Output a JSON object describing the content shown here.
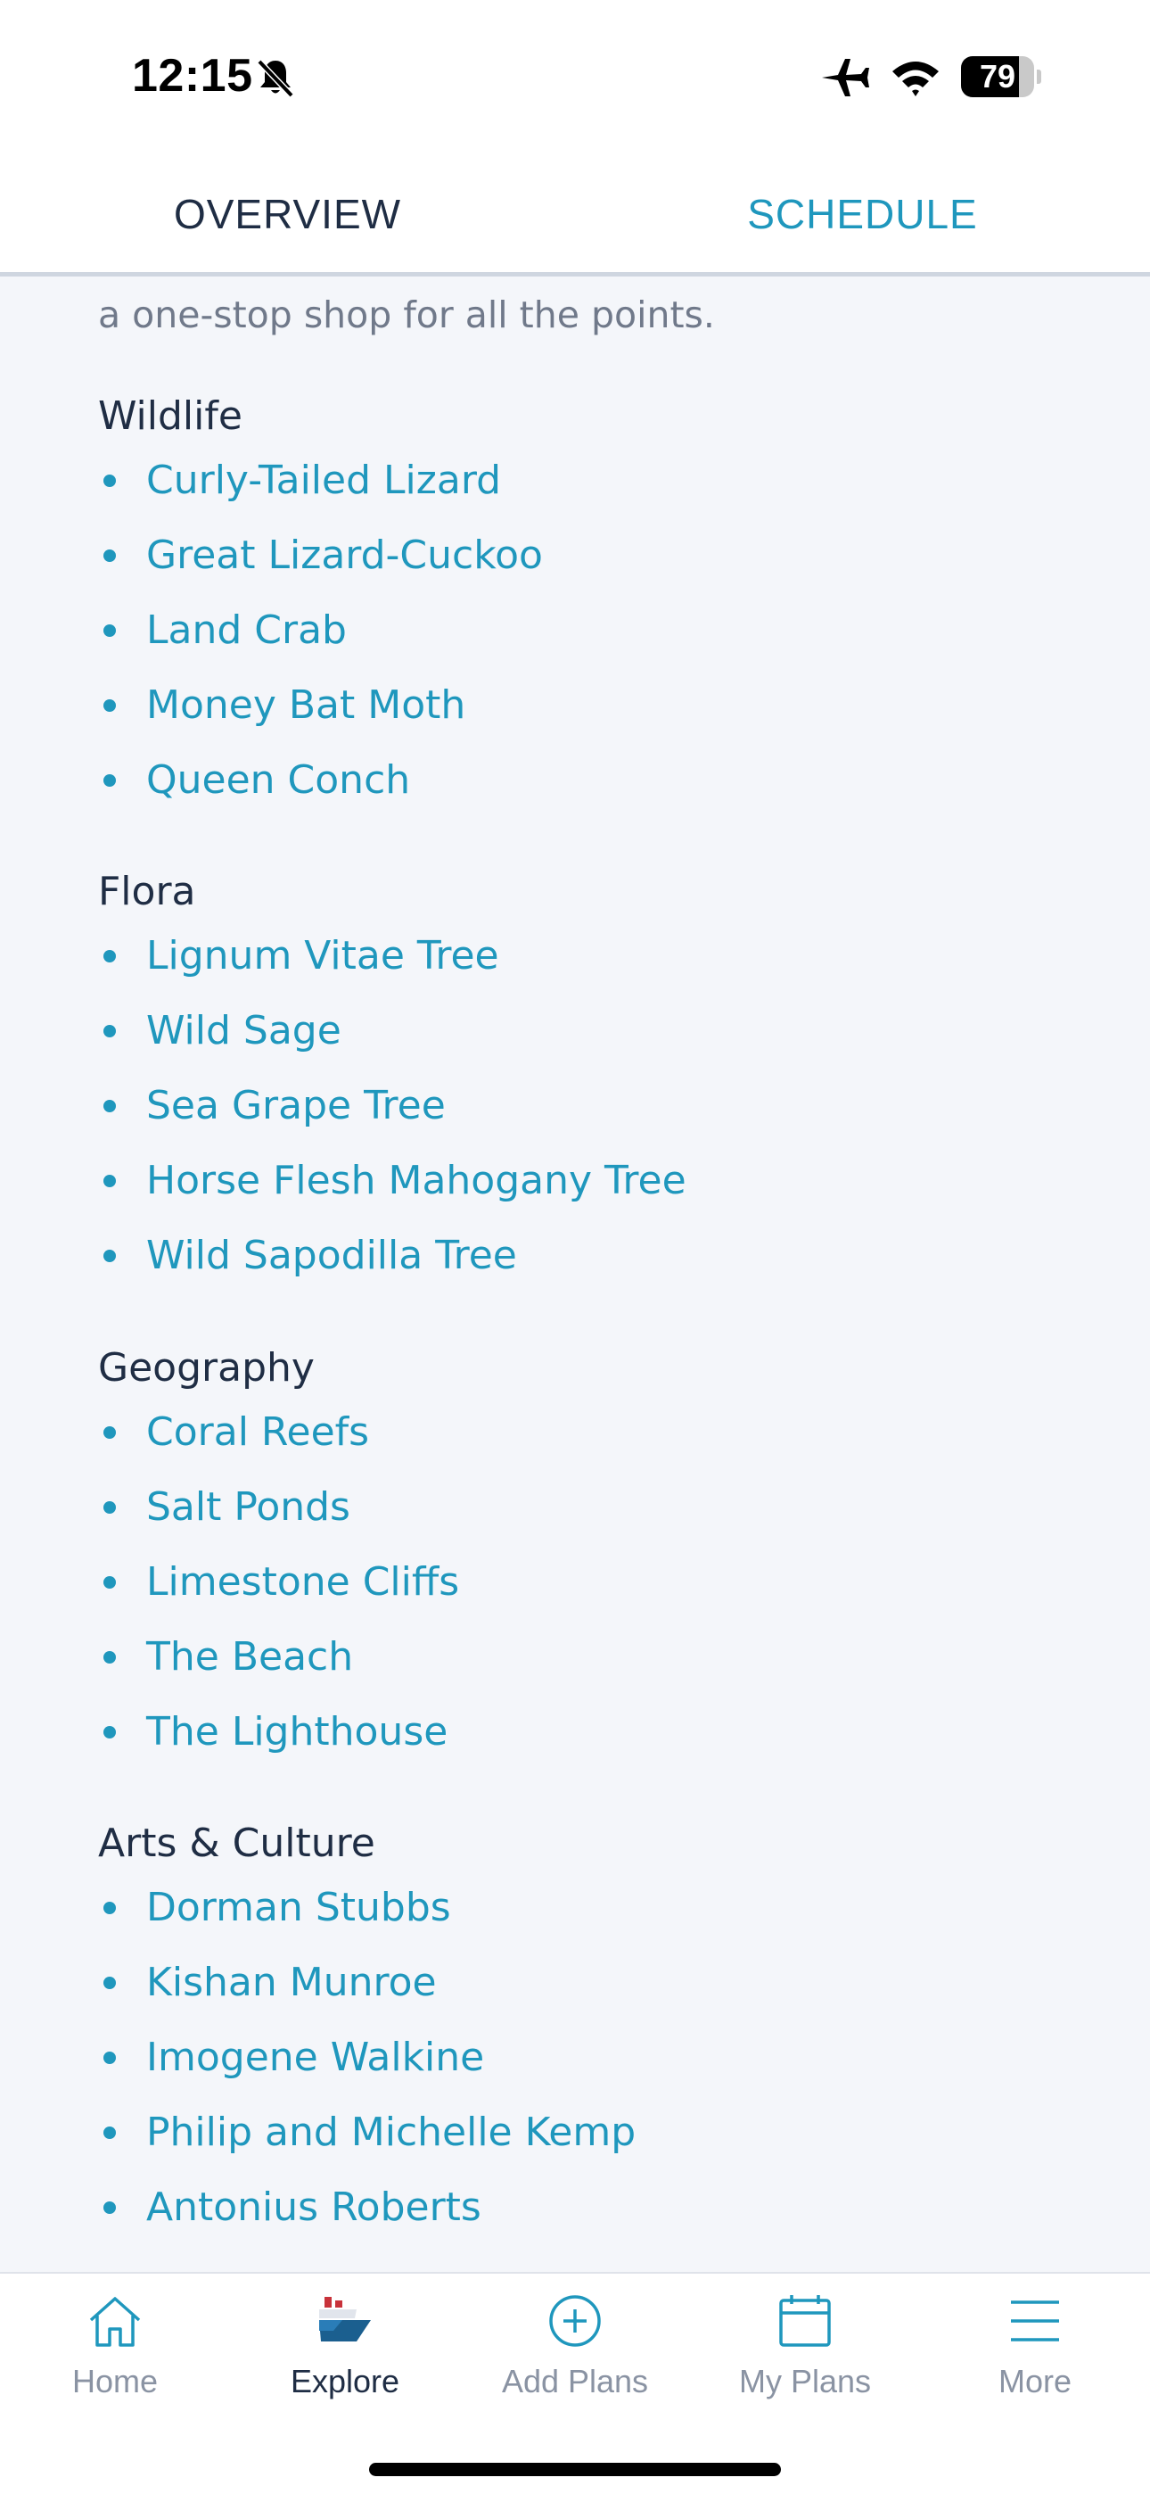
{
  "status_bar": {
    "time": "12:15",
    "battery_level": "79",
    "battery_fraction": 0.79,
    "icons": [
      "bell-off-icon",
      "airplane-icon",
      "wifi-icon",
      "battery-icon"
    ]
  },
  "tabs": [
    {
      "label": "OVERVIEW",
      "active": false
    },
    {
      "label": "SCHEDULE",
      "active": true
    }
  ],
  "content": {
    "intro_tail": "a one-stop shop for all the points.",
    "sections": [
      {
        "title": "Wildlife",
        "items": [
          "Curly-Tailed Lizard",
          "Great Lizard-Cuckoo",
          "Land Crab",
          "Money Bat Moth",
          "Queen Conch"
        ]
      },
      {
        "title": "Flora",
        "items": [
          "Lignum Vitae Tree",
          "Wild Sage",
          "Sea Grape Tree",
          "Horse Flesh Mahogany Tree",
          "Wild Sapodilla Tree"
        ]
      },
      {
        "title": "Geography",
        "items": [
          "Coral Reefs",
          "Salt Ponds",
          "Limestone Cliffs",
          "The Beach",
          "The Lighthouse"
        ]
      },
      {
        "title": "Arts & Culture",
        "items": [
          "Dorman Stubbs",
          "Kishan Munroe",
          "Imogene Walkine",
          "Philip and Michelle Kemp",
          "Antonius Roberts"
        ]
      }
    ]
  },
  "bottom_nav": [
    {
      "label": "Home",
      "icon": "home-icon",
      "active": false
    },
    {
      "label": "Explore",
      "icon": "ship-icon",
      "active": true
    },
    {
      "label": "Add Plans",
      "icon": "plus-circle-icon",
      "active": false
    },
    {
      "label": "My Plans",
      "icon": "calendar-icon",
      "active": false
    },
    {
      "label": "More",
      "icon": "menu-icon",
      "active": false
    }
  ],
  "colors": {
    "accent": "#1f97bd",
    "text_dark": "#1f2d44",
    "text_muted": "#70798a",
    "background": "#f4f6fa",
    "nav_inactive": "#8a93a3"
  }
}
